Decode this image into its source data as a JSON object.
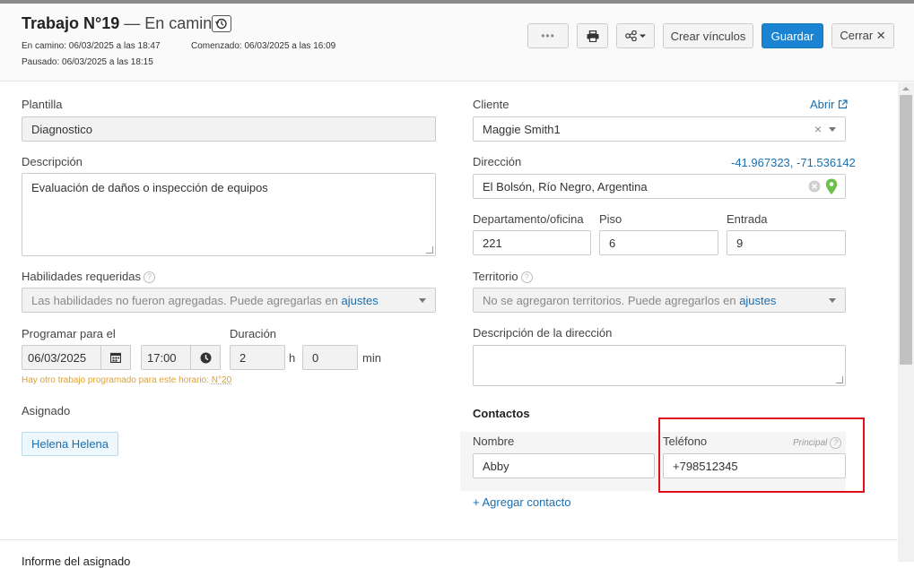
{
  "header": {
    "job_title": "Trabajo N°19",
    "status": "— En camino",
    "en_camino": "En camino: 06/03/2025 a las 18:47",
    "comenzado": "Comenzado: 06/03/2025 a las 16:09",
    "pausado": "Pausado: 06/03/2025 a las 18:15"
  },
  "toolbar": {
    "more_label": "•••",
    "create_links_label": "Crear vínculos",
    "save_label": "Guardar",
    "close_label": "Cerrar ✕"
  },
  "left": {
    "template_label": "Plantilla",
    "template_value": "Diagnostico",
    "description_label": "Descripción",
    "description_value": "Evaluación de daños o inspección de equipos",
    "skills_label": "Habilidades requeridas",
    "skills_placeholder": "Las habilidades no fueron agregadas. Puede agregarlas en",
    "skills_link": "ajustes",
    "schedule_label": "Programar para el",
    "date_value": "06/03/2025",
    "time_value": "17:00",
    "duration_label": "Duración",
    "hours_value": "2",
    "hours_unit": "h",
    "minutes_value": "0",
    "minutes_unit": "min",
    "conflict_warning": "Hay otro trabajo programado para este horario:",
    "conflict_link": "N°20",
    "assigned_label": "Asignado",
    "assigned_value": "Helena Helena",
    "report_label": "Informe del asignado"
  },
  "right": {
    "client_label": "Cliente",
    "open_link": "Abrir",
    "client_value": "Maggie Smith1",
    "address_label": "Dirección",
    "coordinates": "-41.967323, -71.536142",
    "address_value": "El Bolsón, Río Negro, Argentina",
    "department_label": "Departamento/oficina",
    "department_value": "221",
    "floor_label": "Piso",
    "floor_value": "6",
    "entrance_label": "Entrada",
    "entrance_value": "9",
    "territory_label": "Territorio",
    "territory_placeholder": "No se agregaron territorios. Puede agregarlos en",
    "territory_link": "ajustes",
    "address_desc_label": "Descripción de la dirección",
    "contacts_heading": "Contactos",
    "contact_name_label": "Nombre",
    "contact_phone_label": "Teléfono",
    "principal_label": "Principal",
    "contact_name_value": "Abby",
    "contact_phone_value": "+798512345",
    "add_contact": "+ Agregar contacto"
  },
  "colors": {
    "primary": "#1b84d2",
    "link": "#1a6fb0",
    "warning": "#e0a030",
    "highlight": "#e0101a",
    "pin": "#6cc04a"
  }
}
